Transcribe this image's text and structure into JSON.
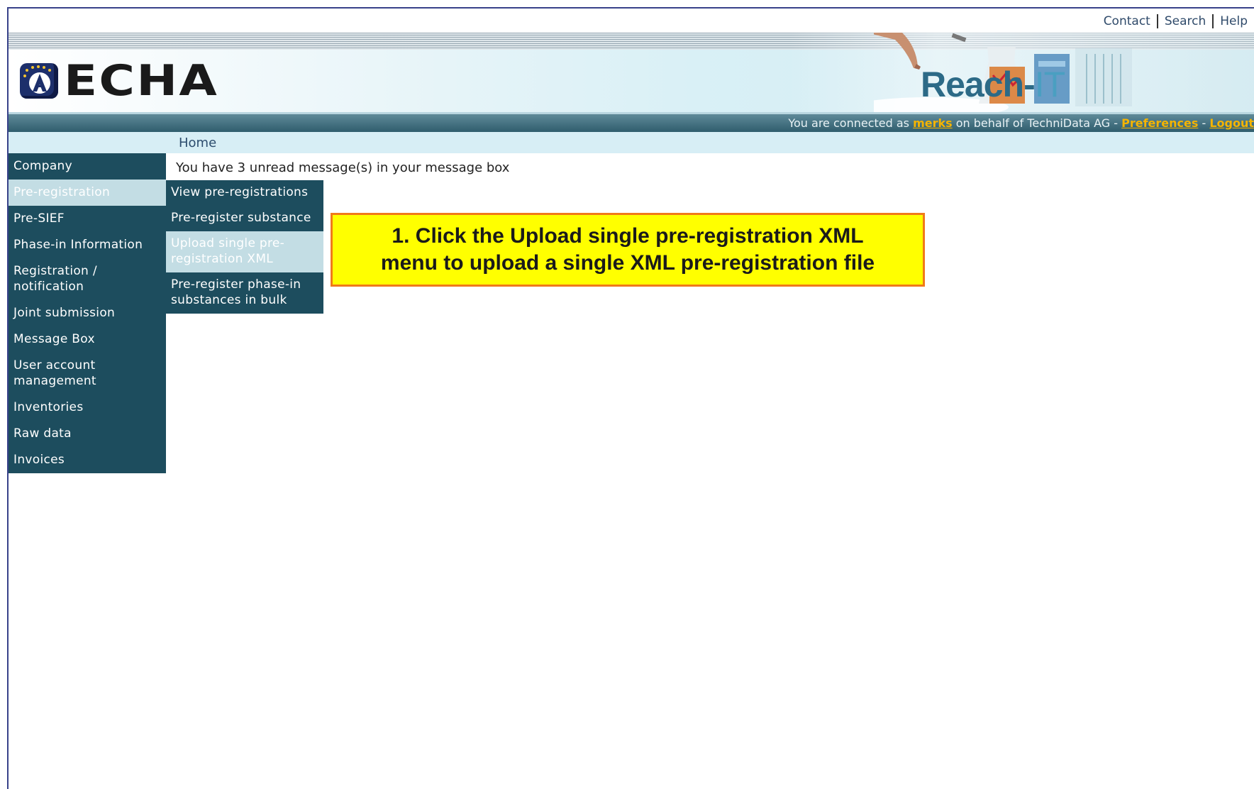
{
  "toplinks": {
    "contact": "Contact",
    "search": "Search",
    "help": "Help"
  },
  "brand": {
    "logo_text": "ECHA",
    "product": "Reach-",
    "product_suffix": "IT"
  },
  "connection": {
    "prefix": "You are connected as ",
    "user": "merks",
    "middle": " on behalf of TechniData AG - ",
    "preferences": "Preferences",
    "dash": " - ",
    "logout": "Logout"
  },
  "breadcrumb": "Home",
  "message": "You have 3 unread message(s) in your message box",
  "nav": {
    "items": [
      {
        "label": "Company"
      },
      {
        "label": "Pre-registration"
      },
      {
        "label": "Pre-SIEF"
      },
      {
        "label": "Phase-in Information"
      },
      {
        "label": "Registration / notification"
      },
      {
        "label": "Joint submission"
      },
      {
        "label": "Message Box"
      },
      {
        "label": "User account management"
      },
      {
        "label": "Inventories"
      },
      {
        "label": "Raw data"
      },
      {
        "label": "Invoices"
      }
    ]
  },
  "submenu": {
    "items": [
      {
        "label": "View pre-registrations"
      },
      {
        "label": "Pre-register substance"
      },
      {
        "label": "Upload single pre-registration XML"
      },
      {
        "label": "Pre-register phase-in substances in bulk"
      }
    ]
  },
  "callout": {
    "line1": "1. Click the Upload single pre-registration XML",
    "line2": "menu to upload a single XML pre-registration file"
  },
  "colors": {
    "nav_bg": "#1d4d5e",
    "active_bg": "#c3dde4",
    "callout_bg": "#ffff00",
    "callout_border": "#f07a1a",
    "link_accent": "#f5b400"
  }
}
